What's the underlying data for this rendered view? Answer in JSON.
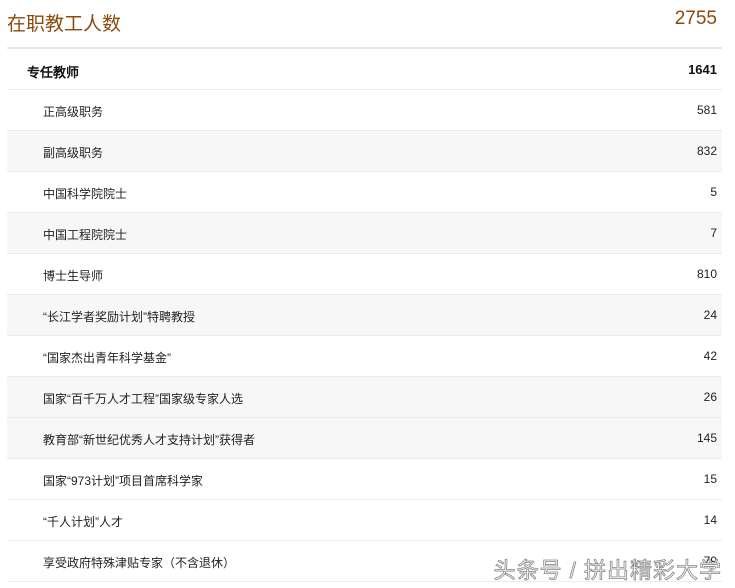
{
  "header": {
    "title": "在职教工人数",
    "total": "2755"
  },
  "main_row": {
    "label": "专任教师",
    "value": "1641"
  },
  "rows": [
    {
      "label": "正高级职务",
      "value": "581"
    },
    {
      "label": "副高级职务",
      "value": "832"
    },
    {
      "label": "中国科学院院士",
      "value": "5"
    },
    {
      "label": "中国工程院院士",
      "value": "7"
    },
    {
      "label": "博士生导师",
      "value": "810"
    },
    {
      "label": "“长江学者奖励计划”特聘教授",
      "value": "24"
    },
    {
      "label": "“国家杰出青年科学基金”",
      "value": "42"
    },
    {
      "label": "国家“百千万人才工程”国家级专家人选",
      "value": "26"
    },
    {
      "label": "教育部“新世纪优秀人才支持计划”获得者",
      "value": "145"
    },
    {
      "label": "国家“973计划”项目首席科学家",
      "value": "15"
    },
    {
      "label": "“千人计划”人才",
      "value": "14"
    },
    {
      "label": "享受政府特殊津贴专家（不含退休）",
      "value": "79"
    }
  ],
  "watermark": "头条号 / 拼出精彩大学"
}
